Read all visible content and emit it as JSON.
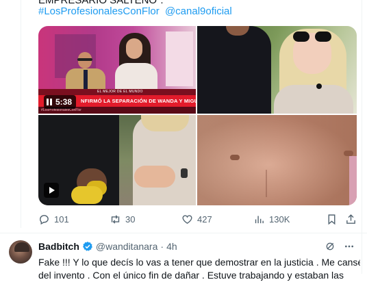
{
  "tweet": {
    "cut_text": "EMPRESARIO SALTEÑO\".",
    "hashtags": [
      "#LosProfesionalesConFlor",
      "@canal9oficial"
    ],
    "media": {
      "video_duration": "5:38",
      "tv_banner": "EL MEJOR DE EL MUNDO",
      "tv_headline": "NFIRMÓ LA SEPARACIÓN DE WANDA Y MIGUELES",
      "tv_hashtag": "#LosProfesionalesConFlor"
    },
    "actions": {
      "replies": "101",
      "retweets": "30",
      "likes": "427",
      "views": "130K"
    }
  },
  "reply": {
    "name": "Badbitch",
    "handle": "@wanditanara",
    "dot": "·",
    "time": "4h",
    "text_line1": "Fake !!! Y lo que decís lo vas a tener que demostrar en la justicia . Me cansé",
    "text_line2": "del invento . Con el único fin de dañar . Estuve trabajando y estaban las"
  },
  "colors": {
    "accent": "#1d9bf0",
    "muted": "#536471",
    "text": "#0f1419",
    "tv_red": "#e21b2b"
  },
  "icons": {
    "reply": "reply-icon",
    "retweet": "retweet-icon",
    "like": "heart-icon",
    "views": "analytics-icon",
    "bookmark": "bookmark-icon",
    "share": "share-icon",
    "verified": "verified-badge-icon",
    "grok": "grok-icon",
    "more": "more-icon"
  }
}
